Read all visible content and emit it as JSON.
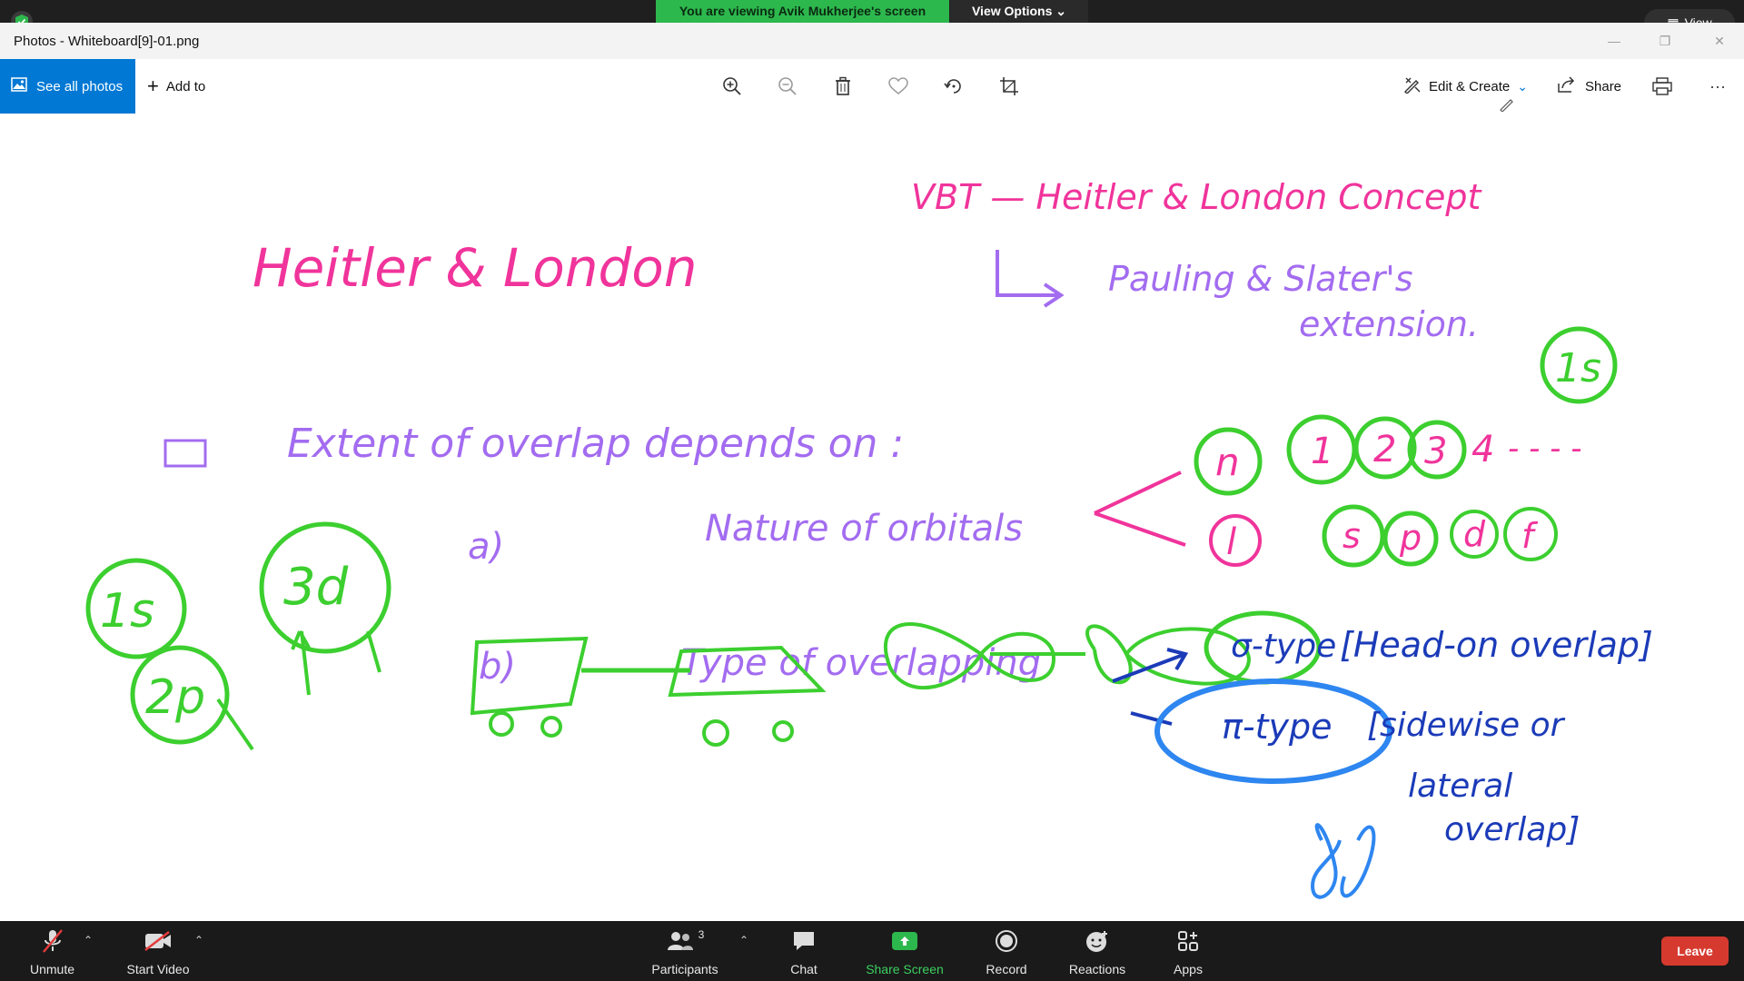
{
  "zoom_top": {
    "banner": "You are viewing Avik Mukherjee's screen",
    "view_options": "View Options",
    "view_pill": "View"
  },
  "window": {
    "title": "Photos - Whiteboard[9]-01.png"
  },
  "toolbar": {
    "see_all_photos": "See all photos",
    "add_to": "Add to",
    "edit_create": "Edit & Create",
    "share": "Share",
    "more": "···"
  },
  "whiteboard": {
    "title_left": "Heitler & London",
    "title_right": "VBT — Heitler & London Concept",
    "extension_line1": "Pauling & Slater's",
    "extension_line2": "extension.",
    "point": "Extent of overlap depends on :",
    "item_a_label": "a)",
    "item_a": "Nature of orbitals",
    "item_b_label": "b)",
    "item_b": "Type of overlapping",
    "n_symbol": "n",
    "l_symbol": "l",
    "numbers": [
      "1",
      "2",
      "3",
      "4",
      "- - - -"
    ],
    "subshells": [
      "s",
      "p",
      "d",
      "f"
    ],
    "orbitals_left": [
      "1s",
      "3d",
      "2p"
    ],
    "orbital_top_right": "1s",
    "sigma_type": "σ-type",
    "sigma_desc": "[Head-on overlap]",
    "pi_type": "π-type",
    "pi_desc_line1": "[sidewise or",
    "pi_desc_line2": "lateral",
    "pi_desc_line3": "overlap]",
    "colors": {
      "pink": "#f0349b",
      "purple": "#a36cf0",
      "green": "#3ccf2f",
      "blue": "#1b3bb8",
      "light_blue": "#2e86f0"
    }
  },
  "zoom_bottom": {
    "unmute": "Unmute",
    "start_video": "Start Video",
    "participants": "Participants",
    "participants_count": "3",
    "chat": "Chat",
    "share_screen": "Share Screen",
    "record": "Record",
    "reactions": "Reactions",
    "apps": "Apps",
    "leave": "Leave"
  }
}
